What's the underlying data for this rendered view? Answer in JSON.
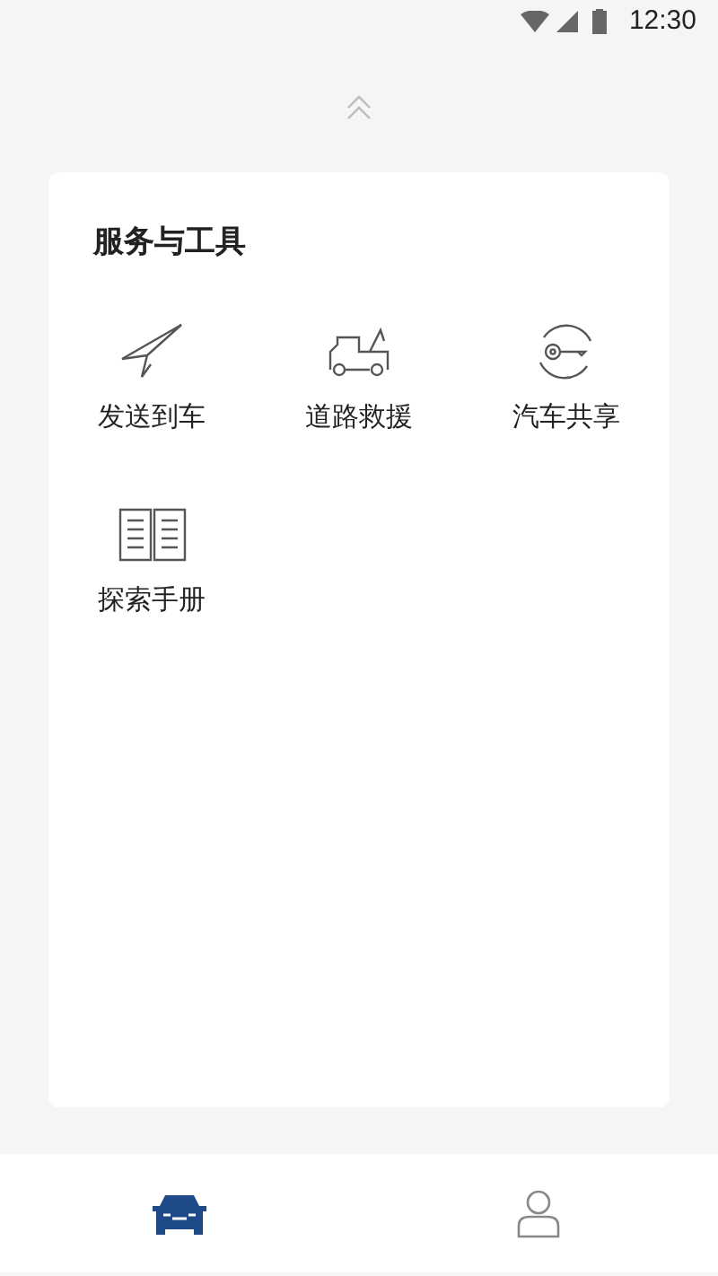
{
  "status_bar": {
    "time": "12:30"
  },
  "card": {
    "title": "服务与工具",
    "items": [
      {
        "kind": "send",
        "label": "发送到车"
      },
      {
        "kind": "tow",
        "label": "道路救援"
      },
      {
        "kind": "share",
        "label": "汽车共享"
      },
      {
        "kind": "manual",
        "label": "探索手册"
      }
    ]
  },
  "bottom_nav": [
    {
      "kind": "car",
      "selected": true
    },
    {
      "kind": "person",
      "selected": false
    }
  ]
}
